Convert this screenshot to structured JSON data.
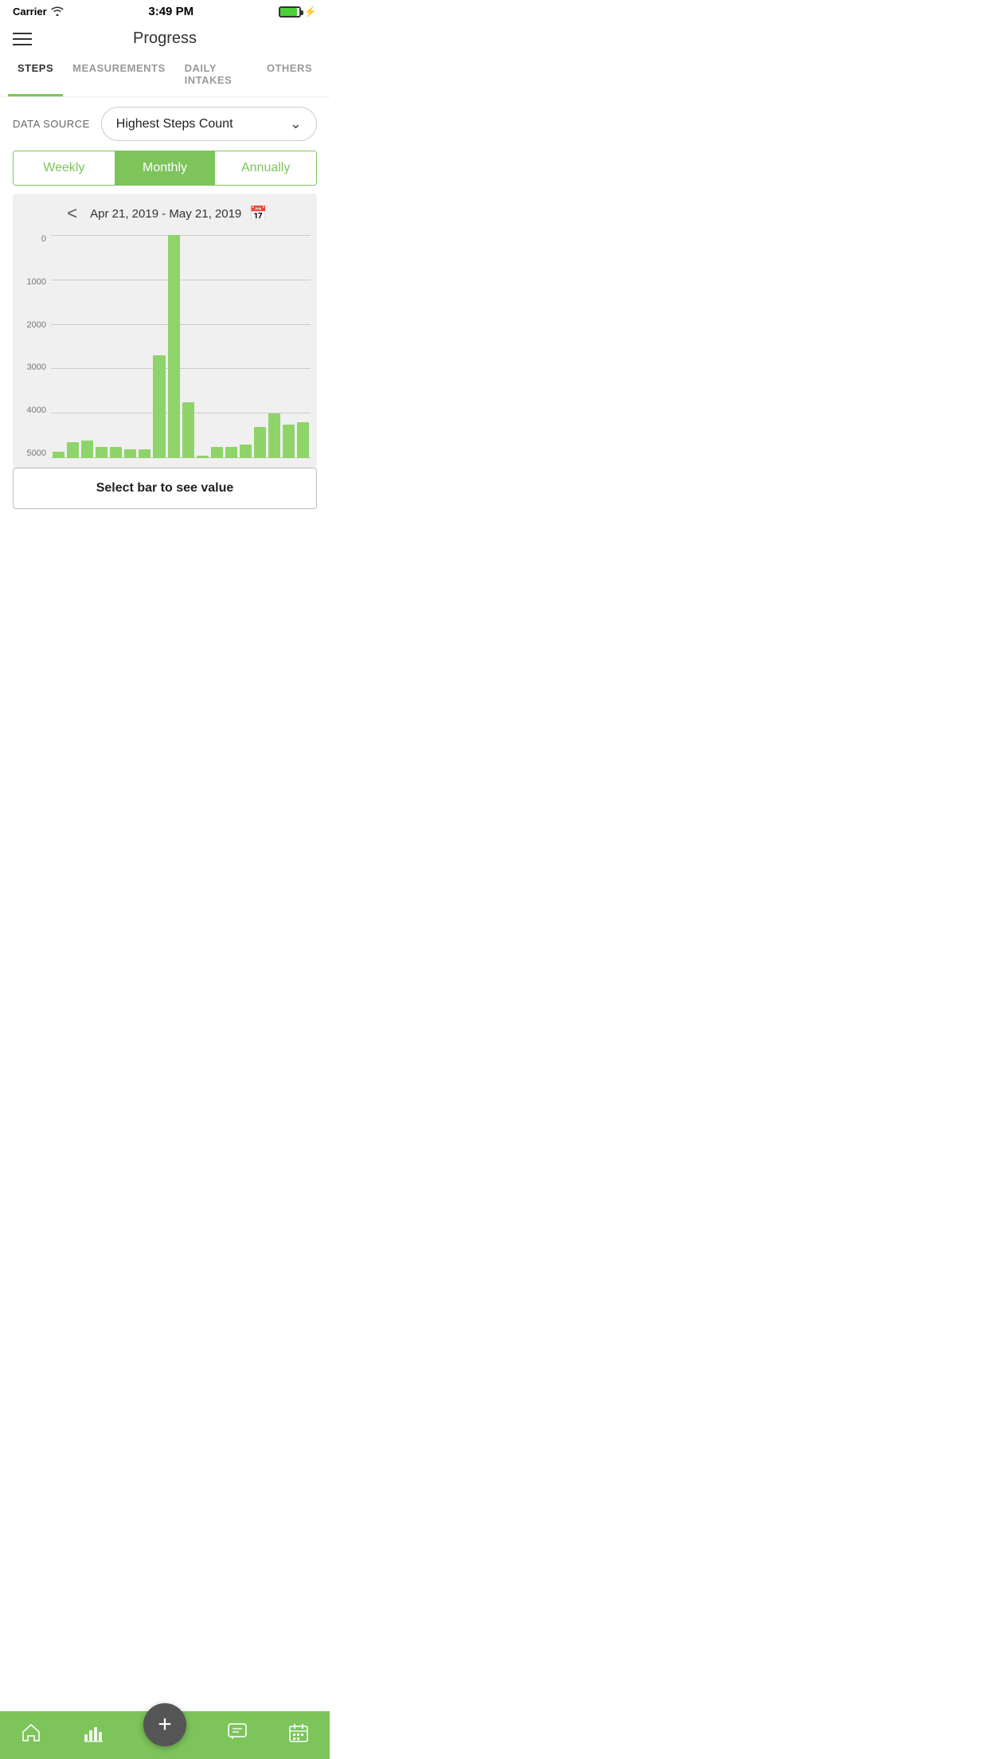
{
  "status_bar": {
    "carrier": "Carrier",
    "time": "3:49 PM"
  },
  "header": {
    "title": "Progress"
  },
  "tabs": [
    {
      "id": "steps",
      "label": "STEPS",
      "active": true
    },
    {
      "id": "measurements",
      "label": "MEASUREMENTS",
      "active": false
    },
    {
      "id": "daily_intakes",
      "label": "DAILY INTAKES",
      "active": false
    },
    {
      "id": "others",
      "label": "OTHERS",
      "active": false
    }
  ],
  "data_source": {
    "label": "DATA SOURCE",
    "selected": "Highest Steps Count"
  },
  "period_toggle": {
    "options": [
      "Weekly",
      "Monthly",
      "Annually"
    ],
    "active_index": 1
  },
  "chart": {
    "date_range": "Apr 21, 2019 - May 21, 2019",
    "y_labels": [
      "5000",
      "4000",
      "3000",
      "2000",
      "1000",
      "0"
    ],
    "bars": [
      {
        "value": 150,
        "height_pct": 3
      },
      {
        "value": 400,
        "height_pct": 7
      },
      {
        "value": 450,
        "height_pct": 8
      },
      {
        "value": 280,
        "height_pct": 5
      },
      {
        "value": 300,
        "height_pct": 5
      },
      {
        "value": 200,
        "height_pct": 4
      },
      {
        "value": 220,
        "height_pct": 4
      },
      {
        "value": 2450,
        "height_pct": 46
      },
      {
        "value": 5300,
        "height_pct": 100
      },
      {
        "value": 1350,
        "height_pct": 25
      },
      {
        "value": 50,
        "height_pct": 1
      },
      {
        "value": 280,
        "height_pct": 5
      },
      {
        "value": 300,
        "height_pct": 5
      },
      {
        "value": 330,
        "height_pct": 6
      },
      {
        "value": 750,
        "height_pct": 14
      },
      {
        "value": 1050,
        "height_pct": 20
      },
      {
        "value": 800,
        "height_pct": 15
      },
      {
        "value": 850,
        "height_pct": 16
      }
    ]
  },
  "select_bar_hint": "Select bar to see value",
  "bottom_nav": {
    "items": [
      {
        "id": "home",
        "icon": "home"
      },
      {
        "id": "progress",
        "icon": "chart"
      },
      {
        "id": "add",
        "icon": "plus",
        "is_fab": true
      },
      {
        "id": "chat",
        "icon": "chat"
      },
      {
        "id": "calendar",
        "icon": "calendar"
      }
    ]
  }
}
